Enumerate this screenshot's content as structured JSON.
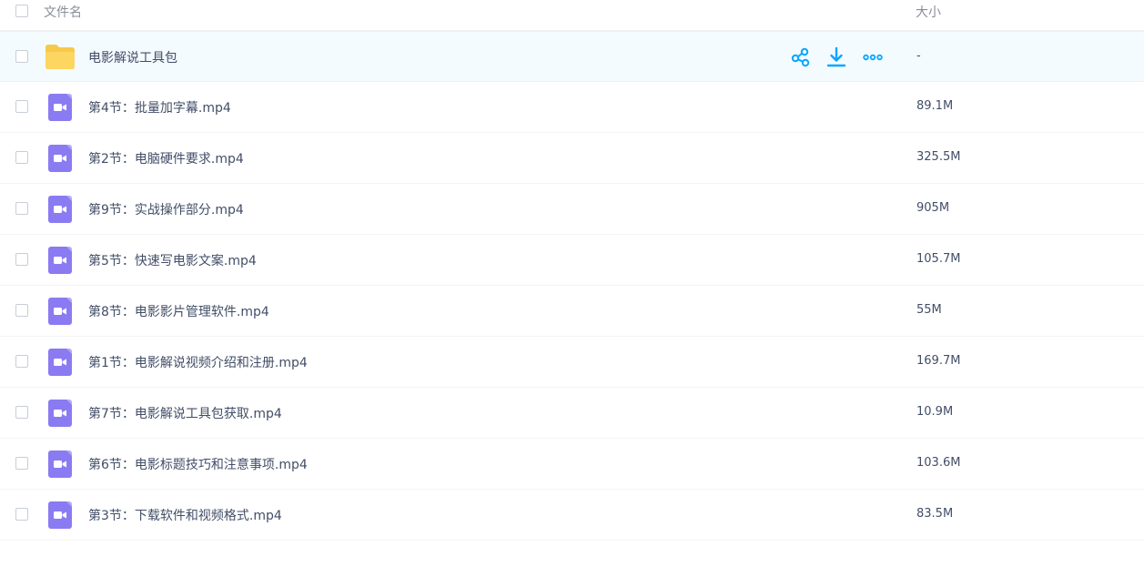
{
  "header": {
    "name_label": "文件名",
    "size_label": "大小"
  },
  "folder": {
    "name": "电影解说工具包",
    "size": "-",
    "icon": "folder-icon"
  },
  "files": [
    {
      "name": "第4节：批量加字幕.mp4",
      "size": "89.1M",
      "icon": "video-file-icon"
    },
    {
      "name": "第2节：电脑硬件要求.mp4",
      "size": "325.5M",
      "icon": "video-file-icon"
    },
    {
      "name": "第9节：实战操作部分.mp4",
      "size": "905M",
      "icon": "video-file-icon"
    },
    {
      "name": "第5节：快速写电影文案.mp4",
      "size": "105.7M",
      "icon": "video-file-icon"
    },
    {
      "name": "第8节：电影影片管理软件.mp4",
      "size": "55M",
      "icon": "video-file-icon"
    },
    {
      "name": "第1节：电影解说视频介绍和注册.mp4",
      "size": "169.7M",
      "icon": "video-file-icon"
    },
    {
      "name": "第7节：电影解说工具包获取.mp4",
      "size": "10.9M",
      "icon": "video-file-icon"
    },
    {
      "name": "第6节：电影标题技巧和注意事项.mp4",
      "size": "103.6M",
      "icon": "video-file-icon"
    },
    {
      "name": "第3节：下载软件和视频格式.mp4",
      "size": "83.5M",
      "icon": "video-file-icon"
    }
  ],
  "colors": {
    "accent": "#06a7ff",
    "video_icon": "#8a7bf2",
    "folder": "#fcd34d",
    "hover_row": "#f4fbff"
  }
}
